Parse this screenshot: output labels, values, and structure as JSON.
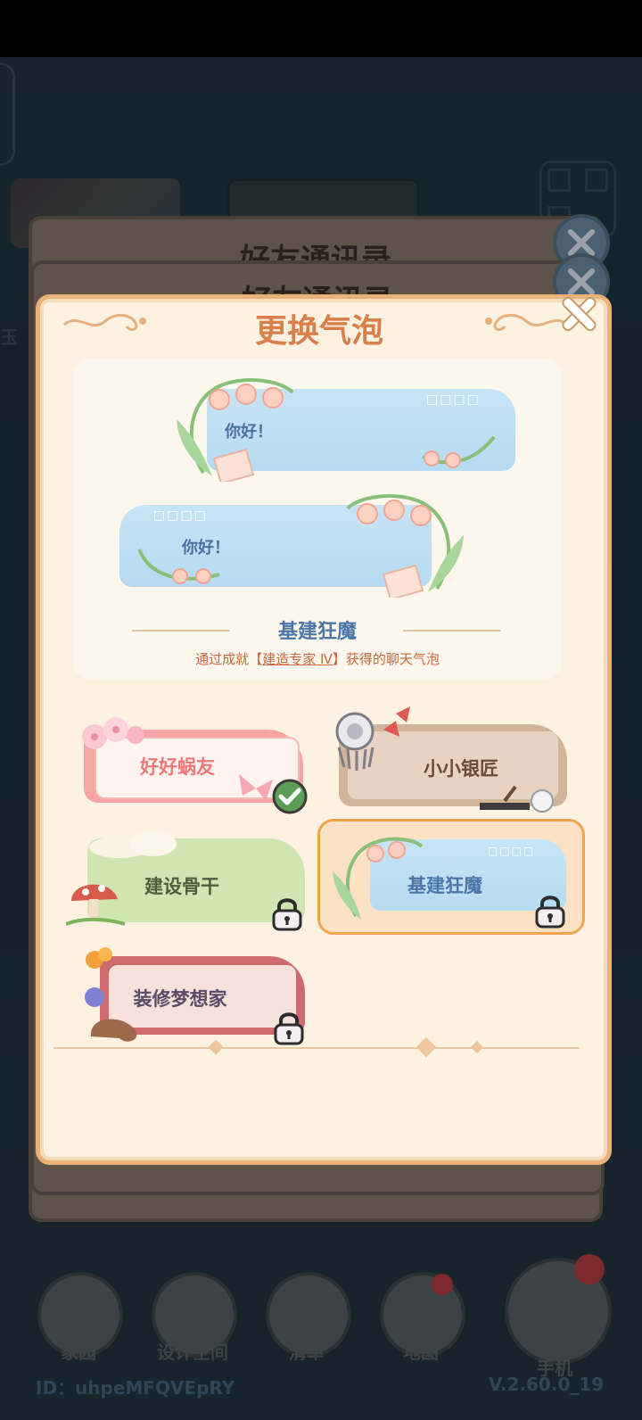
{
  "background": {
    "panel_title_1": "好友通讯录",
    "panel_title_2": "好友通讯录",
    "side_text": "玉",
    "footer_id": "ID：uhpeMFQVEpRY",
    "footer_version": "V.2.60.0_19"
  },
  "dialog": {
    "title": "更换气泡",
    "preview": {
      "bubble_text_1": "你好！",
      "bubble_text_2": "你好！",
      "bubble_dots": "□□□□",
      "name": "基建狂魔",
      "desc_prefix": "通过成就【",
      "desc_highlight": "建造专家 Ⅳ",
      "desc_suffix": "】获得的聊天气泡"
    },
    "options": [
      {
        "label": "好好蜗友",
        "state": "selected"
      },
      {
        "label": "小小银匠",
        "state": "unlocked"
      },
      {
        "label": "建设骨干",
        "state": "locked"
      },
      {
        "label": "基建狂魔",
        "state": "locked-focused"
      },
      {
        "label": "装修梦想家",
        "state": "locked"
      }
    ]
  },
  "nav": {
    "items": [
      "家园",
      "设计空间",
      "清单",
      "地图",
      "手机"
    ]
  },
  "colors": {
    "accent": "#d9804a",
    "frame": "#e9b27a",
    "label_blue": "#4d76a8"
  }
}
